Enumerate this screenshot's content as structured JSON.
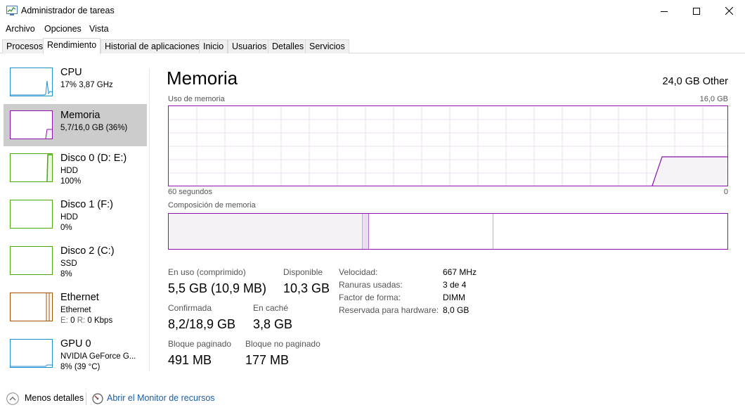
{
  "window": {
    "title": "Administrador de tareas",
    "minimize_icon": "minimize-icon",
    "maximize_icon": "maximize-icon",
    "close_icon": "close-icon"
  },
  "menu": [
    "Archivo",
    "Opciones",
    "Vista"
  ],
  "tabs": [
    "Procesos",
    "Rendimiento",
    "Historial de aplicaciones",
    "Inicio",
    "Usuarios",
    "Detalles",
    "Servicios"
  ],
  "active_tab": "Rendimiento",
  "sidebar": [
    {
      "name": "CPU",
      "line1": "17%  3,87 GHz",
      "line2": "",
      "color": "#1f8ecd"
    },
    {
      "name": "Memoria",
      "line1": "5,7/16,0 GB (36%)",
      "line2": "",
      "color": "#8b12ae",
      "selected": true
    },
    {
      "name": "Disco 0 (D: E:)",
      "line1": "HDD",
      "line2": "100%",
      "color": "#4da60c"
    },
    {
      "name": "Disco 1 (F:)",
      "line1": "HDD",
      "line2": "0%",
      "color": "#4da60c"
    },
    {
      "name": "Disco 2 (C:)",
      "line1": "SSD",
      "line2": "8%",
      "color": "#4da60c"
    },
    {
      "name": "Ethernet",
      "line1": "Ethernet",
      "line2_gray_e": "E:",
      "line2_e_val": "0",
      "line2_gray_r": "R:",
      "line2_r_val": "0 Kbps",
      "color": "#a74f01"
    },
    {
      "name": "GPU 0",
      "line1": "NVIDIA GeForce G...",
      "line2": "8% (39 °C)",
      "color": "#1f8ecd"
    }
  ],
  "main": {
    "title": "Memoria",
    "total": "24,0 GB Other",
    "usage_label": "Uso de memoria",
    "usage_max": "16,0 GB",
    "time_left": "60 segundos",
    "time_right": "0",
    "composition_label": "Composición de memoria",
    "stats": {
      "in_use_label": "En uso (comprimido)",
      "in_use_value": "5,5 GB (10,9 MB)",
      "available_label": "Disponible",
      "available_value": "10,3 GB",
      "committed_label": "Confirmada",
      "committed_value": "8,2/18,9 GB",
      "cached_label": "En caché",
      "cached_value": "3,8 GB",
      "paged_label": "Bloque paginado",
      "paged_value": "491 MB",
      "nonpaged_label": "Bloque no paginado",
      "nonpaged_value": "177 MB"
    },
    "details": [
      {
        "key": "Velocidad:",
        "value": "667 MHz"
      },
      {
        "key": "Ranuras usadas:",
        "value": "3 de 4"
      },
      {
        "key": "Factor de forma:",
        "value": "DIMM"
      },
      {
        "key": "Reservada para hardware:",
        "value": "8,0 GB"
      }
    ]
  },
  "footer": {
    "less_details": "Menos detalles",
    "resource_monitor": "Abrir el Monitor de recursos"
  },
  "colors": {
    "memory": "#8b12ae",
    "memory_fill": "#f4f2f4",
    "link": "#1a5ea8"
  }
}
